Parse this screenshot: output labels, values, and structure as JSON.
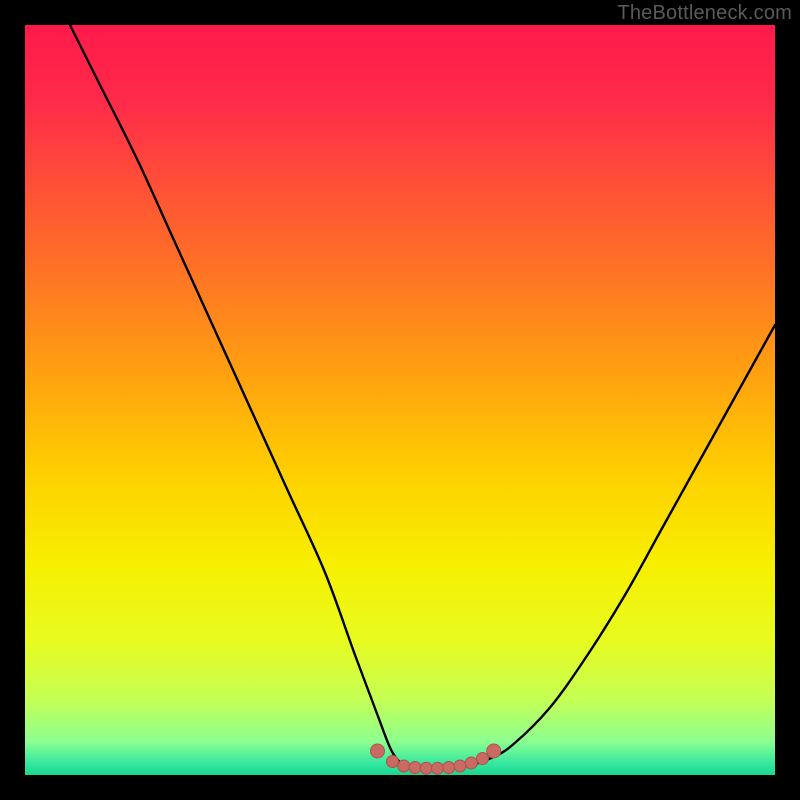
{
  "watermark": "TheBottleneck.com",
  "colors": {
    "gradient_stops": [
      {
        "offset": 0.0,
        "color": "#ff1a4b"
      },
      {
        "offset": 0.1,
        "color": "#ff2a4a"
      },
      {
        "offset": 0.22,
        "color": "#ff5236"
      },
      {
        "offset": 0.35,
        "color": "#ff7a22"
      },
      {
        "offset": 0.48,
        "color": "#ffa60e"
      },
      {
        "offset": 0.6,
        "color": "#ffd000"
      },
      {
        "offset": 0.72,
        "color": "#f7ef00"
      },
      {
        "offset": 0.82,
        "color": "#e8fb20"
      },
      {
        "offset": 0.9,
        "color": "#c4ff55"
      },
      {
        "offset": 0.955,
        "color": "#8dff90"
      },
      {
        "offset": 0.985,
        "color": "#34e7a0"
      },
      {
        "offset": 1.0,
        "color": "#19d68f"
      }
    ],
    "curve": "#000000",
    "marker_fill": "#c96a63",
    "marker_stroke": "#b44f49"
  },
  "chart_data": {
    "type": "line",
    "title": "",
    "xlabel": "",
    "ylabel": "",
    "xlim": [
      0,
      100
    ],
    "ylim": [
      0,
      100
    ],
    "grid": false,
    "series": [
      {
        "name": "bottleneck-curve",
        "x": [
          6,
          10,
          15,
          20,
          25,
          30,
          35,
          40,
          44,
          47,
          49,
          51,
          53,
          56,
          59,
          62,
          65,
          70,
          75,
          80,
          85,
          90,
          95,
          100
        ],
        "y": [
          100,
          92,
          82,
          71,
          60,
          49,
          38,
          27,
          16,
          8,
          3,
          1,
          0.8,
          0.8,
          1.2,
          2.2,
          4,
          9,
          16,
          24,
          33,
          42,
          51,
          60
        ]
      }
    ],
    "markers": {
      "name": "optimal-range",
      "x": [
        47,
        49,
        50.5,
        52,
        53.5,
        55,
        56.5,
        58,
        59.5,
        61,
        62.5
      ],
      "y": [
        3.2,
        1.8,
        1.2,
        1.0,
        0.9,
        0.9,
        1.0,
        1.2,
        1.6,
        2.2,
        3.2
      ]
    }
  }
}
